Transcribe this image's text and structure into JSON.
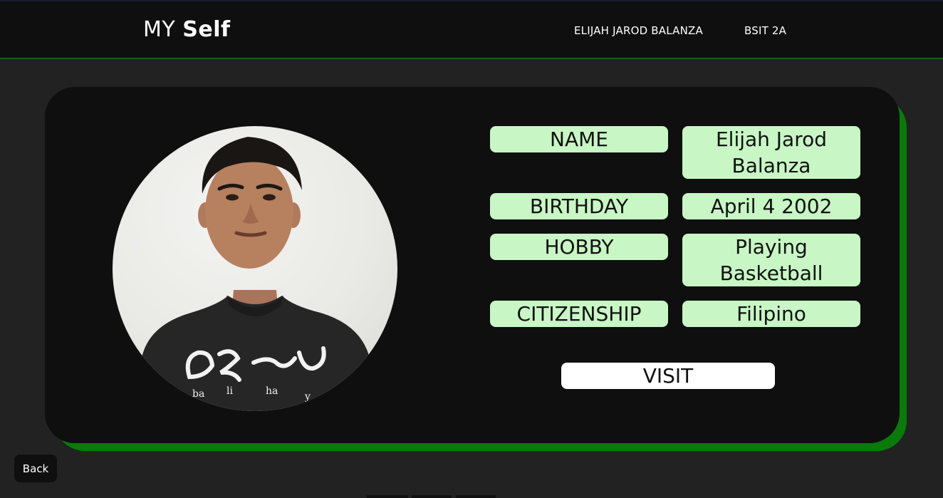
{
  "header": {
    "brand_light": "MY ",
    "brand_bold": "Self",
    "nav": {
      "name": "ELIJAH JAROD BALANZA",
      "section": "BSIT 2A"
    }
  },
  "profile": {
    "photo": {
      "shirt_text": [
        "ba",
        "li",
        "ha",
        "y"
      ]
    },
    "rows": [
      {
        "label": "NAME",
        "value": "Elijah Jarod Balanza"
      },
      {
        "label": "BIRTHDAY",
        "value": "April 4 2002"
      },
      {
        "label": "HOBBY",
        "value": "Playing Basketball"
      },
      {
        "label": "CITIZENSHIP",
        "value": "Filipino"
      }
    ],
    "visit_label": "VISIT"
  },
  "footer": {
    "back_label": "Back"
  },
  "colors": {
    "page_bg": "#222222",
    "card_bg": "#0f0f0f",
    "card_shadow": "#0a7a0a",
    "pill_bg": "#c8f7c5",
    "header_border": "#1e5a1e"
  }
}
